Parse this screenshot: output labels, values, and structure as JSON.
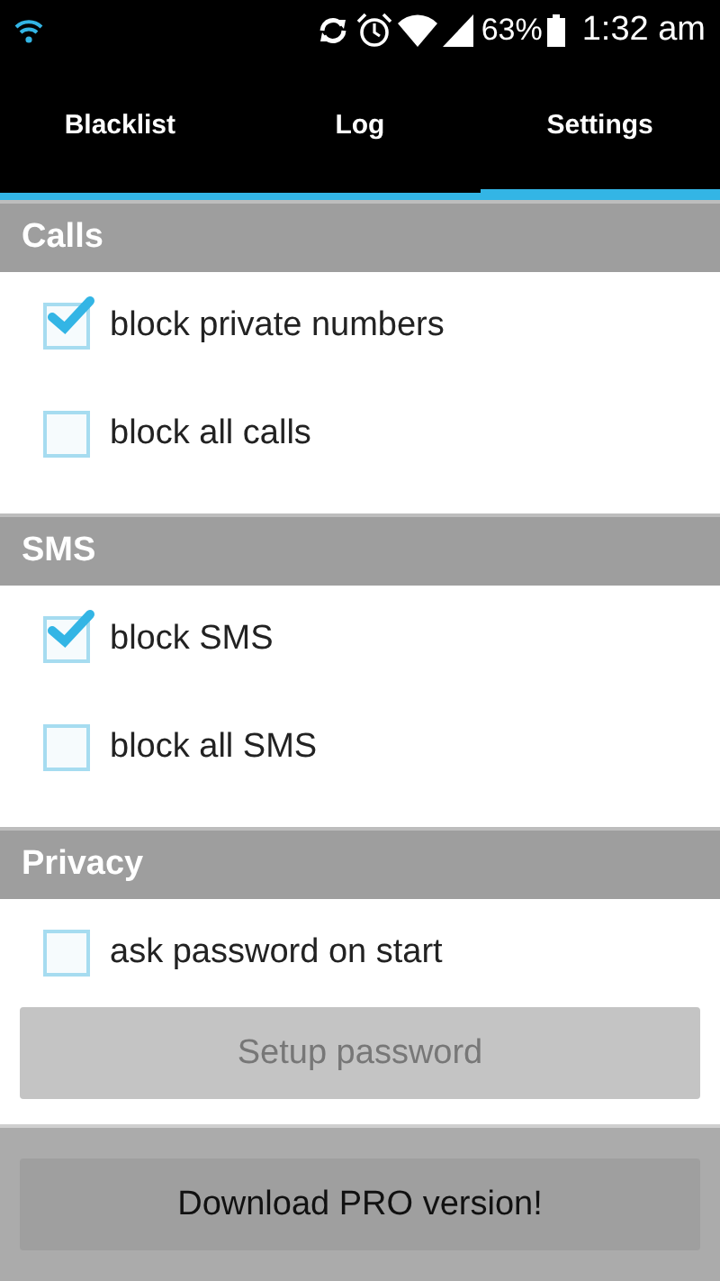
{
  "status_bar": {
    "battery": "63%",
    "time": "1:32 am"
  },
  "tabs": [
    {
      "label": "Blacklist",
      "selected": false
    },
    {
      "label": "Log",
      "selected": false
    },
    {
      "label": "Settings",
      "selected": true
    }
  ],
  "sections": [
    {
      "title": "Calls",
      "options": [
        {
          "label": "block private numbers",
          "checked": true
        },
        {
          "label": "block all calls",
          "checked": false
        }
      ]
    },
    {
      "title": "SMS",
      "options": [
        {
          "label": "block SMS",
          "checked": true
        },
        {
          "label": "block all SMS",
          "checked": false
        }
      ]
    },
    {
      "title": "Privacy",
      "options": [
        {
          "label": "ask password on start",
          "checked": false
        }
      ],
      "button": {
        "label": "Setup password",
        "disabled": true
      }
    }
  ],
  "footer_button": {
    "label": "Download PRO version!"
  }
}
